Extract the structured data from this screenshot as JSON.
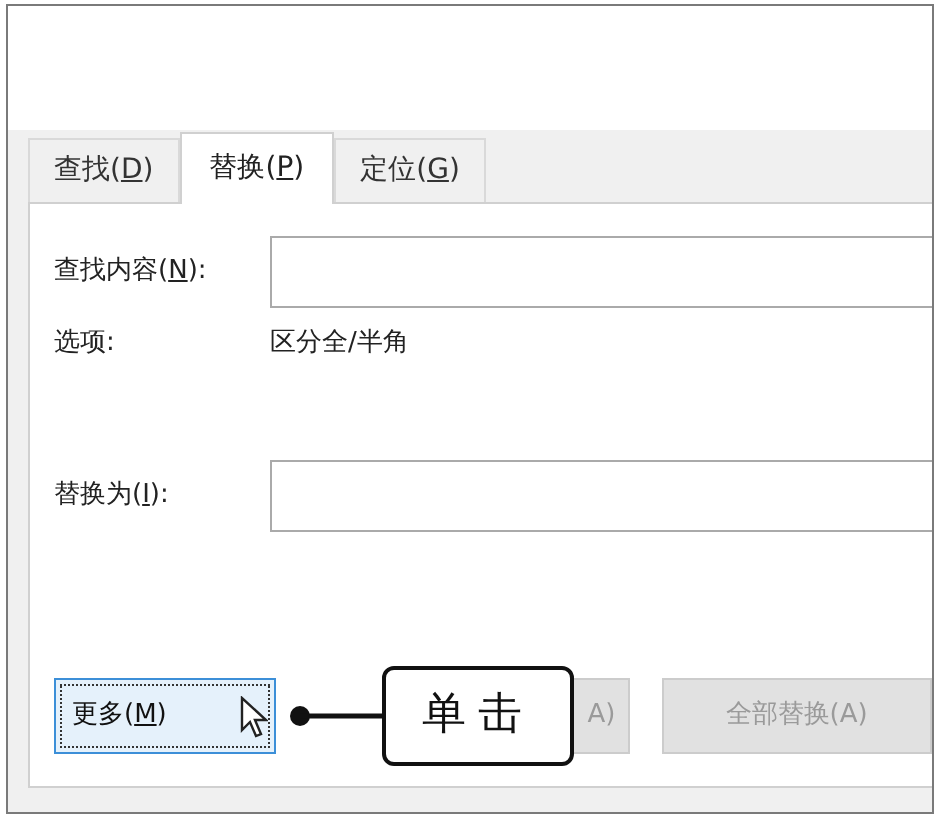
{
  "tabs": [
    {
      "before": "查找(",
      "key": "D",
      "after": ")",
      "selected": false
    },
    {
      "before": "替换(",
      "key": "P",
      "after": ")",
      "selected": true
    },
    {
      "before": "定位(",
      "key": "G",
      "after": ")",
      "selected": false
    }
  ],
  "find": {
    "before": "查找内容(",
    "key": "N",
    "after": "):"
  },
  "options": {
    "label": "选项:",
    "value": "区分全/半角"
  },
  "replace": {
    "before": "替换为(",
    "key": "I",
    "after": "):"
  },
  "buttons": [
    {
      "before": "更多(",
      "key": "M",
      "after": ")",
      "focused": true,
      "disabled": false
    },
    {
      "after": "A)",
      "focused": false,
      "disabled": true
    },
    {
      "before": "全部替换(A)",
      "focused": false,
      "disabled": true
    }
  ],
  "callout": {
    "text": "单击"
  }
}
